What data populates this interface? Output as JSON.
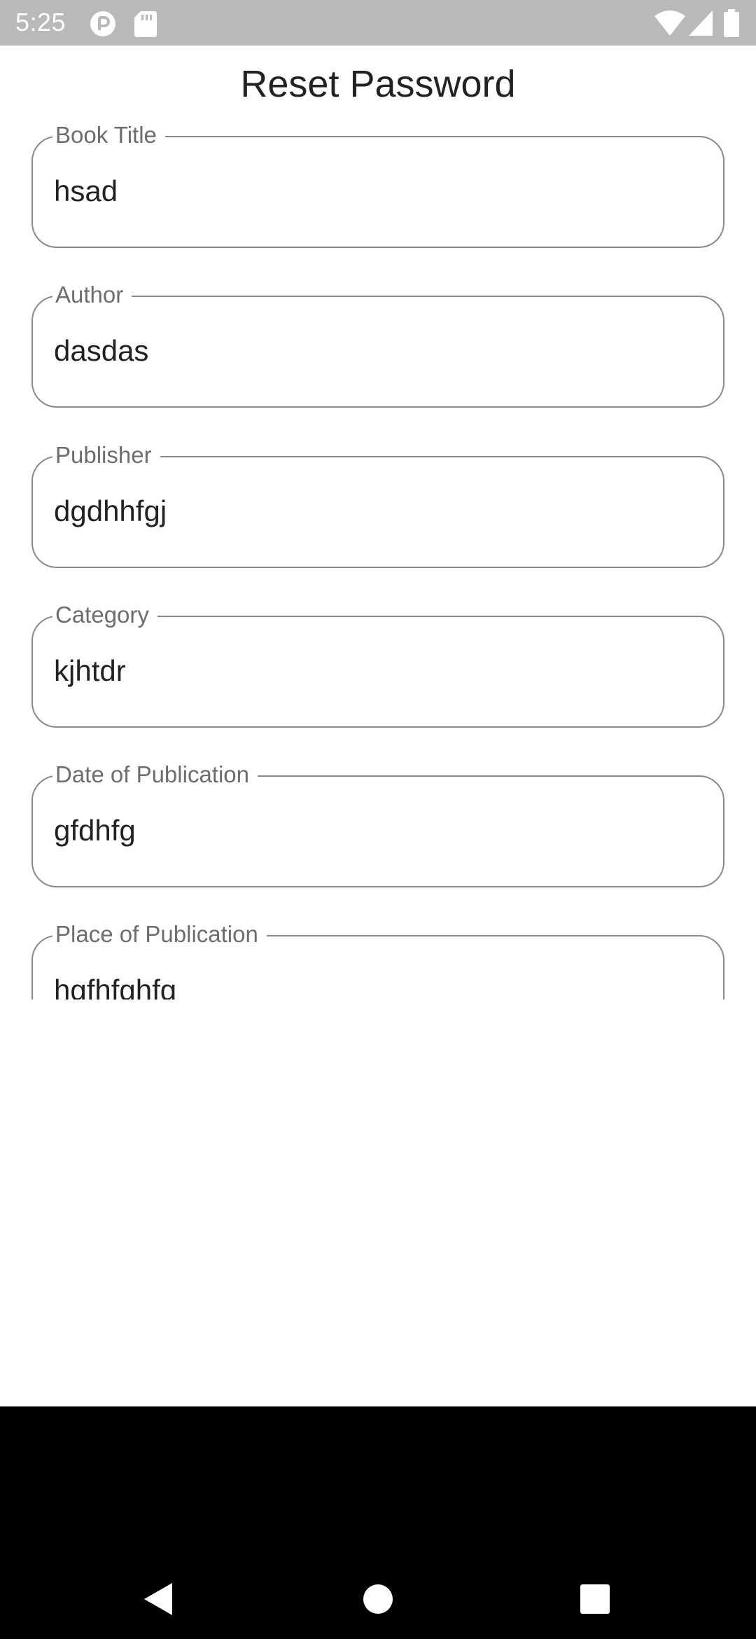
{
  "status_bar": {
    "time": "5:25",
    "background": "#b9b9b9",
    "icons": [
      "circle-p-notification-icon",
      "sd-card-icon",
      "wifi-icon",
      "cell-signal-icon",
      "battery-icon"
    ]
  },
  "app": {
    "title": "Reset Password"
  },
  "form": {
    "fields": [
      {
        "label": "Book Title",
        "value": "hsad"
      },
      {
        "label": "Author",
        "value": "dasdas"
      },
      {
        "label": "Publisher",
        "value": "dgdhhfgj"
      },
      {
        "label": "Category",
        "value": "kjhtdr"
      },
      {
        "label": "Date of Publication",
        "value": "gfdhfg"
      },
      {
        "label": "Place of Publication",
        "value": "hgfhfghfg"
      }
    ]
  },
  "nav_bar": {
    "icons": [
      "back-triangle-icon",
      "home-circle-icon",
      "recents-square-icon"
    ],
    "background": "#000000"
  },
  "colors": {
    "field_border": "#8a8a8a",
    "label_text": "#6d6d6d",
    "value_text": "#222222"
  }
}
